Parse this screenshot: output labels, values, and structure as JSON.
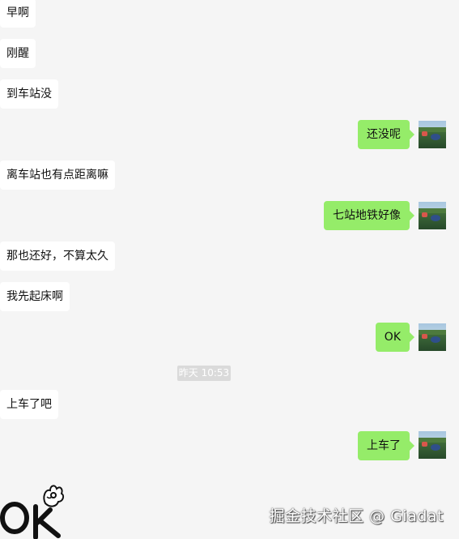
{
  "messages": {
    "m1": "早啊",
    "m2": "刚醒",
    "m3": "到车站没",
    "m4": "还没呢",
    "m5": "离车站也有点距离嘛",
    "m6": "七站地铁好像",
    "m7": "那也还好，不算太久",
    "m8": "我先起床啊",
    "m9": "OK",
    "m10": "上车了吧",
    "m11": "上车了"
  },
  "timestamp": "昨天 10:53",
  "watermark": "掘金技术社区 @ Giadat",
  "colors": {
    "background": "#f5f5f5",
    "incoming_bubble": "#ffffff",
    "outgoing_bubble": "#95ec69",
    "timestamp_bg": "#dadada"
  },
  "icons": {
    "avatar": "landscape-photo-avatar",
    "sticker": "ok-hand-sticker"
  }
}
